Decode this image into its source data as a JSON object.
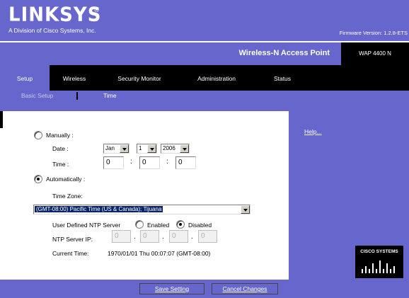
{
  "brand": {
    "logo": "LINKSYS",
    "registered": "®",
    "subtitle": "A Division of Cisco Systems, Inc.",
    "firmware": "Firmware Version: 1.2.8-ETS"
  },
  "product": {
    "name": "Wireless-N Access Point",
    "model": "WAP 4400 N"
  },
  "nav": {
    "tabs": [
      {
        "label": "Setup",
        "active": true
      },
      {
        "label": "Wireless",
        "active": false
      },
      {
        "label": "Security Monitor",
        "active": false
      },
      {
        "label": "Administration",
        "active": false
      },
      {
        "label": "Status",
        "active": false
      }
    ],
    "subtabs": [
      {
        "label": "Basic Setup",
        "active": false
      },
      {
        "label": "Time",
        "active": true
      }
    ]
  },
  "form": {
    "manual_label": "Manually :",
    "manual_selected": false,
    "date_label": "Date :",
    "date_month": "Jan",
    "date_day": "1",
    "date_year": "2006",
    "time_label": "Time :",
    "time_hour": "0",
    "time_minute": "0",
    "time_second": "0",
    "time_sep": ":",
    "auto_label": "Automatically :",
    "auto_selected": true,
    "timezone_label": "Time Zone:",
    "timezone_value": "(GMT-08:00) Pacific Time (US & Canada); Tijuana",
    "ntp_label": "User Defined NTP Server",
    "ntp_enabled_label": "Enabled",
    "ntp_disabled_label": "Disabled",
    "ntp_selected": "Disabled",
    "ntp_ip_label": "NTP Server IP:",
    "ntp_ip": [
      "0",
      "0",
      "0",
      "0"
    ],
    "ip_dot": ".",
    "current_time_label": "Current Time:",
    "current_time_value": "1970/01/01 Thu 00:07:07 (GMT-08:00)"
  },
  "side": {
    "help_label": "Help...",
    "cisco_label": "CISCO SYSTEMS"
  },
  "buttons": {
    "save": "Save Setting",
    "cancel": "Cancel Changes"
  },
  "colors": {
    "brand_purple": "#6666cc",
    "nav_black": "#000000"
  }
}
